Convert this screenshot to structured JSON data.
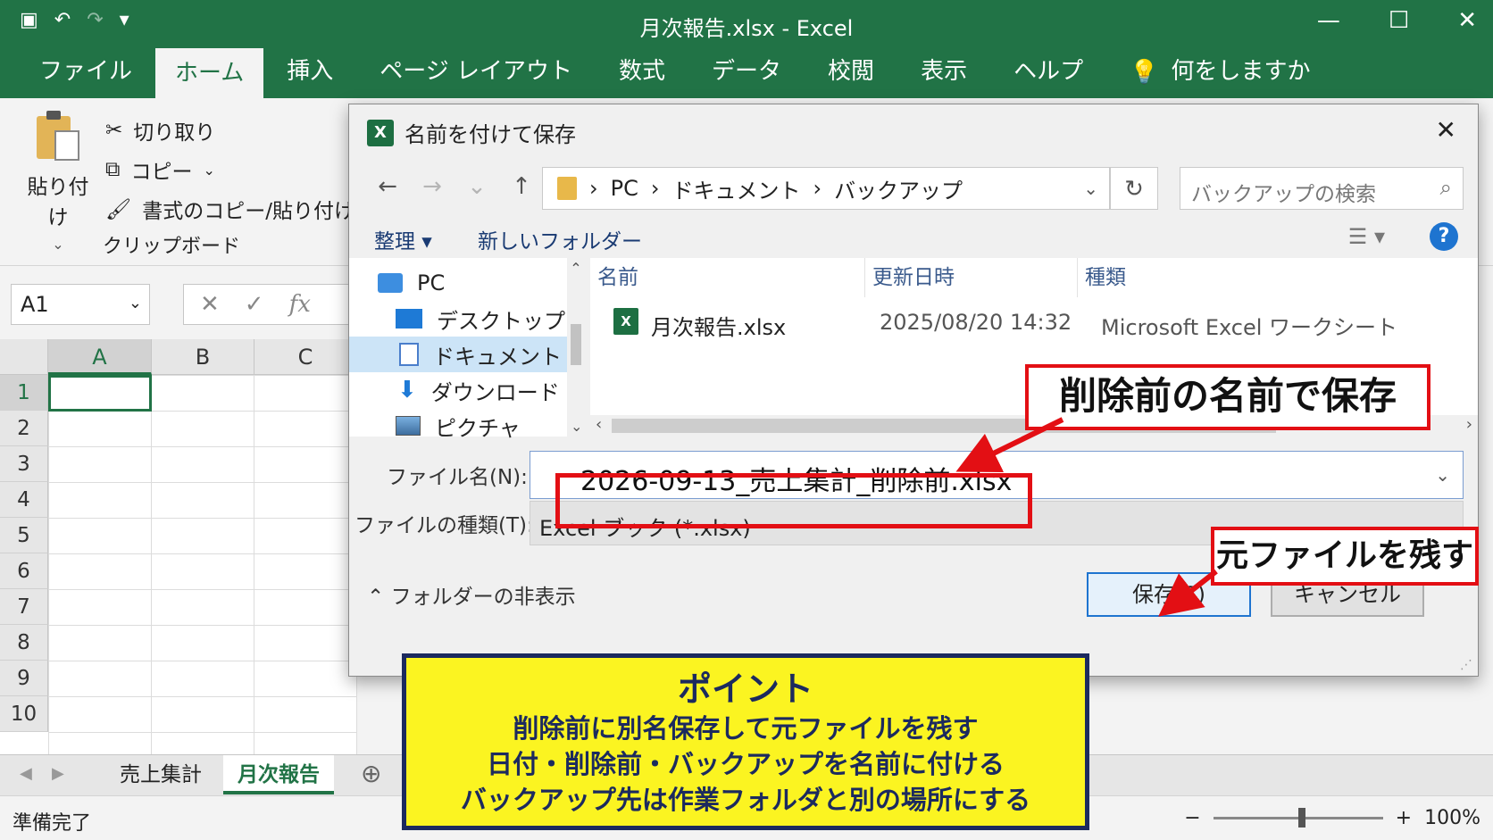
{
  "window": {
    "title": "月次報告.xlsx  -  Excel",
    "minimize": "—",
    "maximize": "☐",
    "close": "✕"
  },
  "qat": {
    "save_icon": "▣",
    "undo_icon": "↶",
    "redo_icon": "↷",
    "more_icon": "▾"
  },
  "ribbon_tabs": [
    "ファイル",
    "ホーム",
    "挿入",
    "ページ レイアウト",
    "数式",
    "データ",
    "校閲",
    "表示",
    "ヘルプ"
  ],
  "tell_me": {
    "icon": "💡",
    "label": "何をしますか"
  },
  "clipboard": {
    "paste": "貼り付け",
    "cut": "切り取り",
    "copy": "コピー",
    "format_painter": "書式のコピー/貼り付け",
    "group_label": "クリップボード"
  },
  "formula_bar": {
    "name_box": "A1",
    "cancel": "✕",
    "enter": "✓",
    "fx": "fx"
  },
  "grid": {
    "columns": [
      "A",
      "B",
      "C"
    ],
    "rows": [
      "1",
      "2",
      "3",
      "4",
      "5",
      "6",
      "7",
      "8",
      "9",
      "10"
    ]
  },
  "sheets": [
    "売上集計",
    "月次報告"
  ],
  "add_sheet": "⊕",
  "status": {
    "ready": "準備完了",
    "zoom_minus": "−",
    "zoom_plus": "+",
    "zoom": "100%"
  },
  "dialog": {
    "title": "名前を付けて保存",
    "close": "✕",
    "nav": {
      "back": "←",
      "forward": "→",
      "recent": "⌄",
      "up": "↑"
    },
    "breadcrumb": [
      "PC",
      "ドキュメント",
      "バックアップ"
    ],
    "breadcrumb_sep": "›",
    "refresh": "↻",
    "search_placeholder": "バックアップの検索",
    "organize": "整理 ▾",
    "new_folder": "新しいフォルダー",
    "nav_items": [
      "PC",
      "デスクトップ",
      "ドキュメント",
      "ダウンロード",
      "ピクチャ"
    ],
    "columns": [
      "名前",
      "更新日時",
      "種類"
    ],
    "files": [
      {
        "name": "月次報告.xlsx",
        "date": "2025/08/20 14:32",
        "type": "Microsoft Excel ワークシート"
      }
    ],
    "filename_label": "ファイル名(N):",
    "filename_value": "2026-09-13_売上集計_削除前.xlsx",
    "filetype_label": "ファイルの種類(T):",
    "filetype_value": "Excel ブック (*.xlsx)",
    "hide_folders": "フォルダーの非表示",
    "save": "保存(S)",
    "cancel": "キャンセル"
  },
  "annotations": {
    "callout_name": "削除前の名前で保存",
    "callout_keep": "元ファイルを残す",
    "point_title": "ポイント",
    "point_lines": [
      "削除前に別名保存して元ファイルを残す",
      "日付・削除前・バックアップを名前に付ける",
      "バックアップ先は作業フォルダと別の場所にする"
    ],
    "accent": "#e30f14",
    "point_bg": "#fbf421",
    "point_border": "#1c2a5e"
  },
  "colors": {
    "excel_green": "#217346"
  }
}
